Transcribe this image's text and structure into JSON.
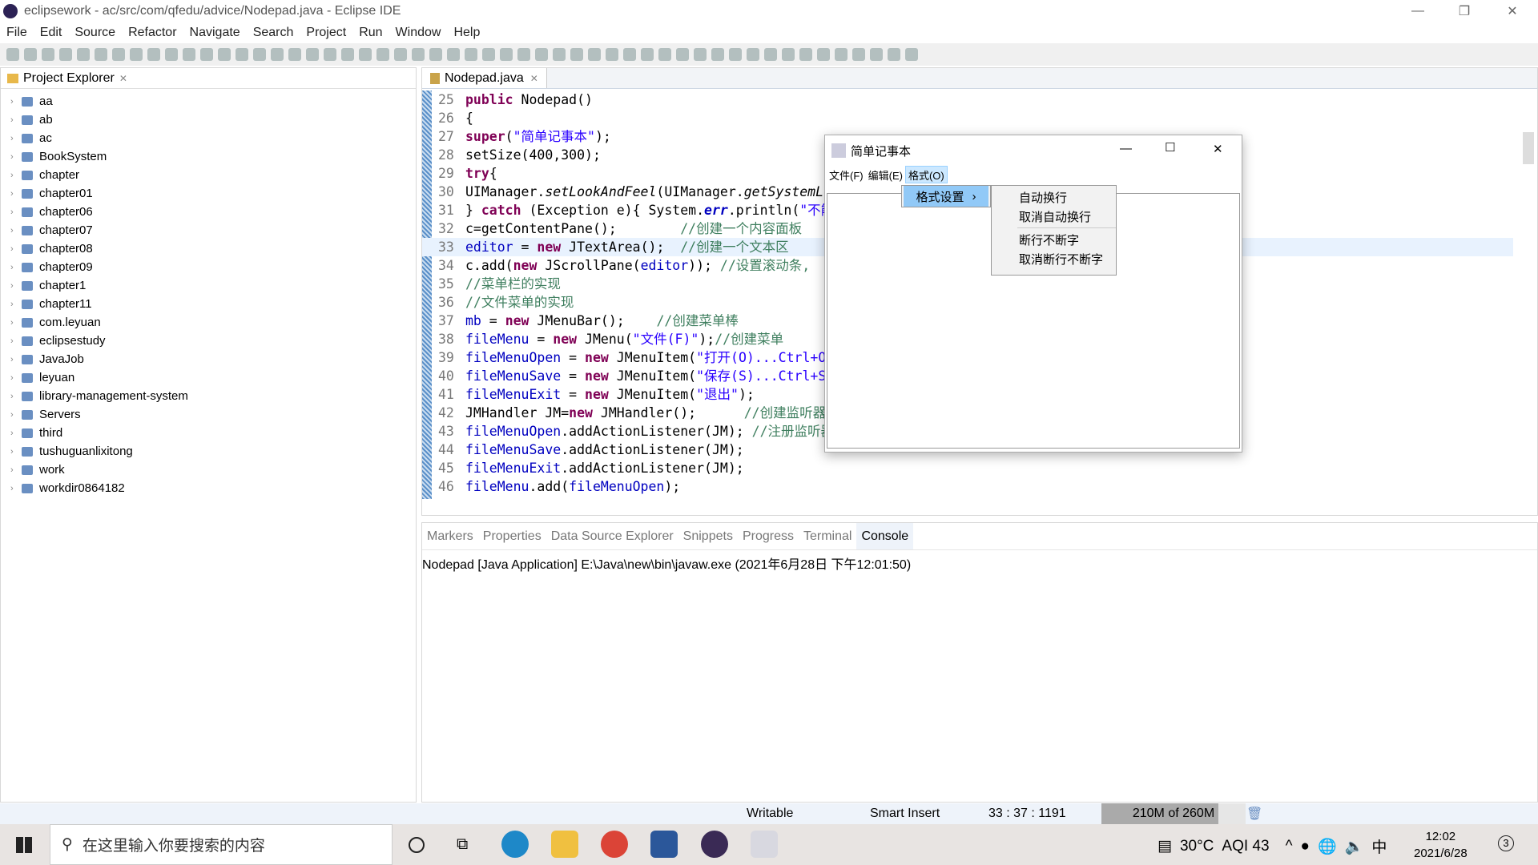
{
  "window": {
    "title": "eclipsework - ac/src/com/qfedu/advice/Nodepad.java - Eclipse IDE"
  },
  "menubar": [
    "File",
    "Edit",
    "Source",
    "Refactor",
    "Navigate",
    "Search",
    "Project",
    "Run",
    "Window",
    "Help"
  ],
  "project_explorer": {
    "title": "Project Explorer",
    "items": [
      "aa",
      "ab",
      "ac",
      "BookSystem",
      "chapter",
      "chapter01",
      "chapter06",
      "chapter07",
      "chapter08",
      "chapter09",
      "chapter1",
      "chapter11",
      "com.leyuan",
      "eclipsestudy",
      "JavaJob",
      "leyuan",
      "library-management-system",
      "Servers",
      "third",
      "tushuguanlixitong",
      "work",
      "workdir0864182"
    ]
  },
  "editor": {
    "tab": "Nodepad.java",
    "current_line": "33",
    "lines": [
      {
        "n": "25",
        "html": "<span class='kw'>public</span> Nodepad()"
      },
      {
        "n": "26",
        "html": "{"
      },
      {
        "n": "27",
        "html": "<span class='kw'>super</span>(<span class='st'>\"简单记事本\"</span>);"
      },
      {
        "n": "28",
        "html": "setSize(400,300);"
      },
      {
        "n": "29",
        "html": "<span class='kw'>try</span>{"
      },
      {
        "n": "30",
        "html": "UIManager.<span class='it'>setLookAndFeel</span>(UIManager.<span class='it'>getSystemLookAndFeelClassName</span>());"
      },
      {
        "n": "31",
        "html": "} <span class='kw'>catch</span> (Exception e){ System.<span class='fd it' style='font-weight:bold'>err</span>.println(<span class='st'>\"不能设置外观\"</span>);}"
      },
      {
        "n": "32",
        "html": "c=getContentPane();        <span class='cm'>//创建一个内容面板</span>"
      },
      {
        "n": "33",
        "html": "<span class='fd'>editor</span> = <span class='kw'>new</span> JTextArea();  <span class='cm'>//创建一个文本区</span>"
      },
      {
        "n": "34",
        "html": "c.add(<span class='kw'>new</span> JScrollPane(<span class='fd'>editor</span>)); <span class='cm'>//设置滚动条,</span>"
      },
      {
        "n": "35",
        "html": "<span class='cm'>//菜单栏的实现</span>"
      },
      {
        "n": "36",
        "html": "<span class='cm'>//文件菜单的实现</span>"
      },
      {
        "n": "37",
        "html": "<span class='fd'>mb</span> = <span class='kw'>new</span> JMenuBar();    <span class='cm'>//创建菜单棒</span>"
      },
      {
        "n": "38",
        "html": "<span class='fd'>fileMenu</span> = <span class='kw'>new</span> JMenu(<span class='st'>\"文件(F)\"</span>);<span class='cm'>//创建菜单</span>"
      },
      {
        "n": "39",
        "html": "<span class='fd'>fileMenuOpen</span> = <span class='kw'>new</span> JMenuItem(<span class='st'>\"打开(O)...Ctrl+O\"</span>);"
      },
      {
        "n": "40",
        "html": "<span class='fd'>fileMenuSave</span> = <span class='kw'>new</span> JMenuItem(<span class='st'>\"保存(S)...Ctrl+S\"</span>);"
      },
      {
        "n": "41",
        "html": "<span class='fd'>fileMenuExit</span> = <span class='kw'>new</span> JMenuItem(<span class='st'>\"退出\"</span>);"
      },
      {
        "n": "42",
        "html": "JMHandler JM=<span class='kw'>new</span> JMHandler();      <span class='cm'>//创建监听器</span>"
      },
      {
        "n": "43",
        "html": "<span class='fd'>fileMenuOpen</span>.addActionListener(JM); <span class='cm'>//注册监听器</span>"
      },
      {
        "n": "44",
        "html": "<span class='fd'>fileMenuSave</span>.addActionListener(JM);"
      },
      {
        "n": "45",
        "html": "<span class='fd'>fileMenuExit</span>.addActionListener(JM);"
      },
      {
        "n": "46",
        "html": "<span class='fd'>fileMenu</span>.add(<span class='fd'>fileMenuOpen</span>);"
      }
    ]
  },
  "bottom_tabs": [
    "Markers",
    "Properties",
    "Data Source Explorer",
    "Snippets",
    "Progress",
    "Terminal",
    "Console"
  ],
  "console": {
    "title": "Nodepad [Java Application] E:\\Java\\new\\bin\\javaw.exe (2021年6月28日 下午12:01:50)"
  },
  "statusbar": {
    "mode": "Writable",
    "insert": "Smart Insert",
    "position": "33 : 37 : 1191",
    "memory": "210M of 260M",
    "memory_used_fraction": 0.81
  },
  "dialog": {
    "title": "简单记事本",
    "menus": [
      "文件(F)",
      "编辑(E)",
      "格式(O)"
    ],
    "submenu": "格式设置",
    "subitems": [
      "自动换行",
      "取消自动换行",
      "断行不断字",
      "取消断行不断字"
    ]
  },
  "taskbar": {
    "search_placeholder": "在这里输入你要搜索的内容",
    "weather": "30°C",
    "aqi": "AQI 43",
    "ime": "中",
    "time": "12:02",
    "date": "2021/6/28",
    "notifications": "3"
  },
  "colors": {
    "accent": "#cce8ff",
    "selection": "#99c9ef"
  }
}
